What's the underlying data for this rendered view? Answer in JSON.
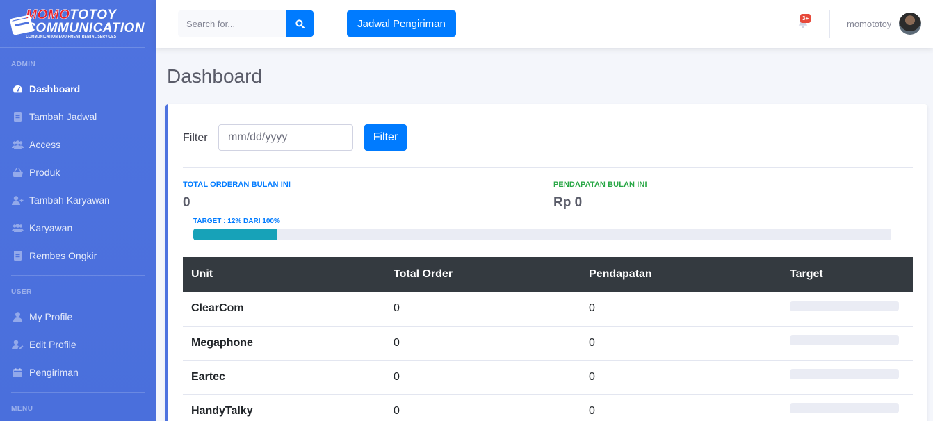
{
  "brand": {
    "line1_a": "MOMO",
    "line1_b": "TOTOY",
    "line2": "COMMUNICATION",
    "line3": "COMMUNICATION EQUIPMENT RENTAL SERVICES"
  },
  "sidebar": {
    "sections": [
      {
        "heading": "ADMIN",
        "items": [
          {
            "label": "Dashboard",
            "icon": "tachometer-icon",
            "active": true
          },
          {
            "label": "Tambah Jadwal",
            "icon": "file-icon"
          },
          {
            "label": "Access",
            "icon": "users-icon"
          },
          {
            "label": "Produk",
            "icon": "basket-icon"
          },
          {
            "label": "Tambah Karyawan",
            "icon": "user-plus-icon"
          },
          {
            "label": "Karyawan",
            "icon": "users-icon"
          },
          {
            "label": "Rembes Ongkir",
            "icon": "file-icon"
          }
        ]
      },
      {
        "heading": "USER",
        "items": [
          {
            "label": "My Profile",
            "icon": "user-icon"
          },
          {
            "label": "Edit Profile",
            "icon": "user-edit-icon"
          },
          {
            "label": "Pengiriman",
            "icon": "calendar-icon"
          }
        ]
      },
      {
        "heading": "MENU",
        "items": []
      }
    ]
  },
  "topbar": {
    "search_placeholder": "Search for...",
    "jadwal_button": "Jadwal Pengiriman",
    "alert_badge": "3+",
    "username": "momototoy"
  },
  "main": {
    "title": "Dashboard",
    "filter_label": "Filter",
    "date_placeholder": "mm/dd/yyyy",
    "filter_button": "Filter",
    "stats": {
      "orders_label": "TOTAL ORDERAN BULAN INI",
      "orders_value": "0",
      "income_label": "PENDAPATAN BULAN INI",
      "income_value": "Rp 0"
    },
    "target_label": "TARGET : 12% DARI 100%",
    "target_percent": 12,
    "colors": {
      "primary": "#007bff",
      "info": "#17a2b8",
      "success": "#28a745",
      "sidebar": "#4e73df"
    },
    "table": {
      "headers": [
        "Unit",
        "Total Order",
        "Pendapatan",
        "Target"
      ],
      "rows": [
        {
          "unit": "ClearCom",
          "total_order": "0",
          "pendapatan": "0",
          "target_percent": 0
        },
        {
          "unit": "Megaphone",
          "total_order": "0",
          "pendapatan": "0",
          "target_percent": 0
        },
        {
          "unit": "Eartec",
          "total_order": "0",
          "pendapatan": "0",
          "target_percent": 0
        },
        {
          "unit": "HandyTalky",
          "total_order": "0",
          "pendapatan": "0",
          "target_percent": 0
        }
      ]
    }
  }
}
